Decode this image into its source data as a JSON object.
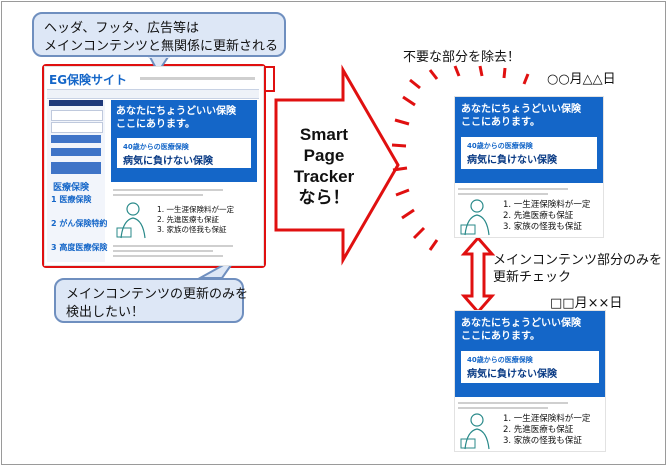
{
  "callouts": {
    "top": [
      "ヘッダ、フッタ、広告等は",
      "メインコンテンツと無関係に更新される"
    ],
    "bottom": [
      "メインコンテンツの更新のみを",
      "検出したい！"
    ]
  },
  "arrow_text": [
    "Smart",
    "Page",
    "Tracker",
    "なら！"
  ],
  "remove_label": "不要な部分を除去！",
  "date_top": "○○月△△日",
  "date_bottom": "□□月××日",
  "check_label": [
    "メインコンテンツ部分のみを",
    "更新チェック"
  ],
  "site": {
    "logo": "EG保険サイト",
    "hero_lines": [
      "あなたにちょうどいい保険",
      "ここにあります。"
    ],
    "sub_small": "40歳からの医療保険",
    "sub_big": "病気に負けない保険",
    "benefits": [
      "1. 一生涯保険料が一定",
      "2. 先進医療も保証",
      "3. 家族の怪我も保証"
    ],
    "sidebar_title": "医療保険",
    "sidebar_items": [
      "1 医療保険",
      "2 がん保険特約",
      "3 高度医療保険"
    ]
  },
  "colors": {
    "accent_blue": "#1466c8",
    "alert_red": "#e01010",
    "callout_fill": "#dde7f6",
    "callout_border": "#6f8fbf"
  }
}
